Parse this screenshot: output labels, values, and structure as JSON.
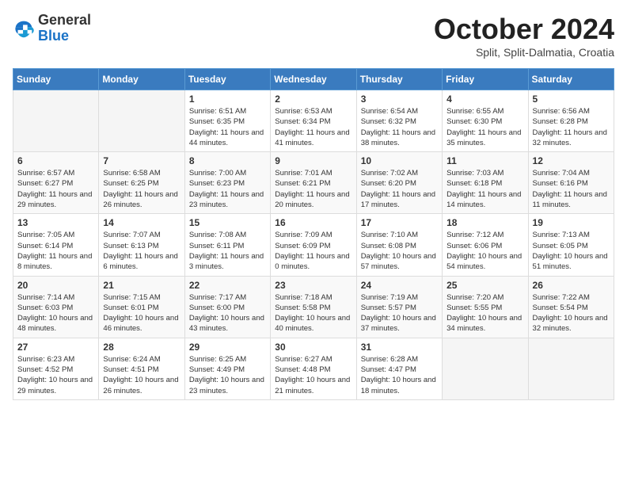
{
  "header": {
    "logo_general": "General",
    "logo_blue": "Blue",
    "month_title": "October 2024",
    "subtitle": "Split, Split-Dalmatia, Croatia"
  },
  "weekdays": [
    "Sunday",
    "Monday",
    "Tuesday",
    "Wednesday",
    "Thursday",
    "Friday",
    "Saturday"
  ],
  "weeks": [
    [
      {
        "day": "",
        "info": ""
      },
      {
        "day": "",
        "info": ""
      },
      {
        "day": "1",
        "info": "Sunrise: 6:51 AM\nSunset: 6:35 PM\nDaylight: 11 hours and 44 minutes."
      },
      {
        "day": "2",
        "info": "Sunrise: 6:53 AM\nSunset: 6:34 PM\nDaylight: 11 hours and 41 minutes."
      },
      {
        "day": "3",
        "info": "Sunrise: 6:54 AM\nSunset: 6:32 PM\nDaylight: 11 hours and 38 minutes."
      },
      {
        "day": "4",
        "info": "Sunrise: 6:55 AM\nSunset: 6:30 PM\nDaylight: 11 hours and 35 minutes."
      },
      {
        "day": "5",
        "info": "Sunrise: 6:56 AM\nSunset: 6:28 PM\nDaylight: 11 hours and 32 minutes."
      }
    ],
    [
      {
        "day": "6",
        "info": "Sunrise: 6:57 AM\nSunset: 6:27 PM\nDaylight: 11 hours and 29 minutes."
      },
      {
        "day": "7",
        "info": "Sunrise: 6:58 AM\nSunset: 6:25 PM\nDaylight: 11 hours and 26 minutes."
      },
      {
        "day": "8",
        "info": "Sunrise: 7:00 AM\nSunset: 6:23 PM\nDaylight: 11 hours and 23 minutes."
      },
      {
        "day": "9",
        "info": "Sunrise: 7:01 AM\nSunset: 6:21 PM\nDaylight: 11 hours and 20 minutes."
      },
      {
        "day": "10",
        "info": "Sunrise: 7:02 AM\nSunset: 6:20 PM\nDaylight: 11 hours and 17 minutes."
      },
      {
        "day": "11",
        "info": "Sunrise: 7:03 AM\nSunset: 6:18 PM\nDaylight: 11 hours and 14 minutes."
      },
      {
        "day": "12",
        "info": "Sunrise: 7:04 AM\nSunset: 6:16 PM\nDaylight: 11 hours and 11 minutes."
      }
    ],
    [
      {
        "day": "13",
        "info": "Sunrise: 7:05 AM\nSunset: 6:14 PM\nDaylight: 11 hours and 8 minutes."
      },
      {
        "day": "14",
        "info": "Sunrise: 7:07 AM\nSunset: 6:13 PM\nDaylight: 11 hours and 6 minutes."
      },
      {
        "day": "15",
        "info": "Sunrise: 7:08 AM\nSunset: 6:11 PM\nDaylight: 11 hours and 3 minutes."
      },
      {
        "day": "16",
        "info": "Sunrise: 7:09 AM\nSunset: 6:09 PM\nDaylight: 11 hours and 0 minutes."
      },
      {
        "day": "17",
        "info": "Sunrise: 7:10 AM\nSunset: 6:08 PM\nDaylight: 10 hours and 57 minutes."
      },
      {
        "day": "18",
        "info": "Sunrise: 7:12 AM\nSunset: 6:06 PM\nDaylight: 10 hours and 54 minutes."
      },
      {
        "day": "19",
        "info": "Sunrise: 7:13 AM\nSunset: 6:05 PM\nDaylight: 10 hours and 51 minutes."
      }
    ],
    [
      {
        "day": "20",
        "info": "Sunrise: 7:14 AM\nSunset: 6:03 PM\nDaylight: 10 hours and 48 minutes."
      },
      {
        "day": "21",
        "info": "Sunrise: 7:15 AM\nSunset: 6:01 PM\nDaylight: 10 hours and 46 minutes."
      },
      {
        "day": "22",
        "info": "Sunrise: 7:17 AM\nSunset: 6:00 PM\nDaylight: 10 hours and 43 minutes."
      },
      {
        "day": "23",
        "info": "Sunrise: 7:18 AM\nSunset: 5:58 PM\nDaylight: 10 hours and 40 minutes."
      },
      {
        "day": "24",
        "info": "Sunrise: 7:19 AM\nSunset: 5:57 PM\nDaylight: 10 hours and 37 minutes."
      },
      {
        "day": "25",
        "info": "Sunrise: 7:20 AM\nSunset: 5:55 PM\nDaylight: 10 hours and 34 minutes."
      },
      {
        "day": "26",
        "info": "Sunrise: 7:22 AM\nSunset: 5:54 PM\nDaylight: 10 hours and 32 minutes."
      }
    ],
    [
      {
        "day": "27",
        "info": "Sunrise: 6:23 AM\nSunset: 4:52 PM\nDaylight: 10 hours and 29 minutes."
      },
      {
        "day": "28",
        "info": "Sunrise: 6:24 AM\nSunset: 4:51 PM\nDaylight: 10 hours and 26 minutes."
      },
      {
        "day": "29",
        "info": "Sunrise: 6:25 AM\nSunset: 4:49 PM\nDaylight: 10 hours and 23 minutes."
      },
      {
        "day": "30",
        "info": "Sunrise: 6:27 AM\nSunset: 4:48 PM\nDaylight: 10 hours and 21 minutes."
      },
      {
        "day": "31",
        "info": "Sunrise: 6:28 AM\nSunset: 4:47 PM\nDaylight: 10 hours and 18 minutes."
      },
      {
        "day": "",
        "info": ""
      },
      {
        "day": "",
        "info": ""
      }
    ]
  ]
}
